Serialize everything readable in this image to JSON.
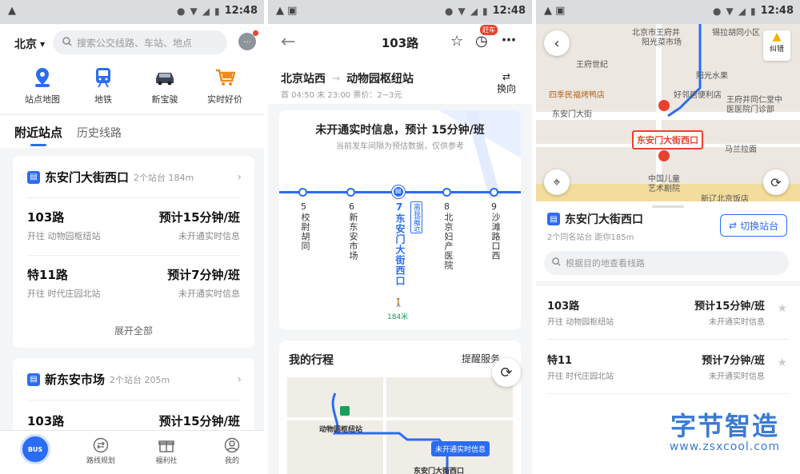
{
  "status": {
    "time": "12:48"
  },
  "s1": {
    "city": "北京",
    "search_placeholder": "搜索公交线路、车站、地点",
    "quick": [
      {
        "label": "站点地图",
        "icon": "pin-icon"
      },
      {
        "label": "地铁",
        "icon": "train-icon"
      },
      {
        "label": "新宝骏",
        "icon": "car-icon"
      },
      {
        "label": "实时好价",
        "icon": "cart-icon"
      }
    ],
    "tabs": {
      "active": "附近站点",
      "other": "历史线路"
    },
    "stop1": {
      "name": "东安门大街西口",
      "meta": "2个站台 184m",
      "rows": [
        {
          "route": "103路",
          "dir": "开往 动物园枢纽站",
          "eta": "预计15分钟/班",
          "rt": "未开通实时信息"
        },
        {
          "route": "特11路",
          "dir": "开往 时代庄园北站",
          "eta": "预计7分钟/班",
          "rt": "未开通实时信息"
        }
      ],
      "expand": "展开全部"
    },
    "stop2": {
      "name": "新东安市场",
      "meta": "2个站台 205m",
      "rows": [
        {
          "route": "103路",
          "eta": "预计15分钟/班"
        }
      ]
    },
    "nav": [
      {
        "label": "",
        "icon": "bus-icon"
      },
      {
        "label": "路线规划",
        "icon": "route-icon"
      },
      {
        "label": "福利社",
        "icon": "gift-icon"
      },
      {
        "label": "我的",
        "icon": "profile-icon"
      }
    ],
    "nav_bus_text": "BUS"
  },
  "s2": {
    "title": "103路",
    "catch_badge": "赶车",
    "from": "北京站西",
    "to": "动物园枢纽站",
    "schedule": "首 04:50 末 23:00 票价：2~3元",
    "reverse": "换向",
    "notice_main": "未开通实时信息，预计 15分钟/班",
    "notice_sub": "当前发车间隔为预估数据，仅供参考",
    "stations": [
      {
        "num": "5",
        "name": "校尉胡同"
      },
      {
        "num": "6",
        "name": "新东安市场"
      },
      {
        "num": "7",
        "name": "东安门大街西口"
      },
      {
        "num": "8",
        "name": "北京妇产医院"
      },
      {
        "num": "9",
        "name": "沙滩路口西"
      }
    ],
    "nearest_tag": "离我最近",
    "walk_dist": "184米",
    "trip_title": "我的行程",
    "remind": "提醒服务",
    "map_labels": {
      "terminal": "动物园枢纽站",
      "bubble": "未开通实时信息",
      "stop": "东安门大街西口"
    }
  },
  "s3": {
    "correct": "纠错",
    "map_pois": [
      "北京市王府井",
      "阳光菜市场",
      "锡拉胡同小区",
      "王府世纪",
      "阳光水果",
      "四季民福烤鸭店",
      "好邻居便利店",
      "王府井同仁堂中",
      "医医院门诊部",
      "东安门大街",
      "东安门大街西口",
      "马兰拉面",
      "中国儿童",
      "艺术剧院",
      "新辽北京饭店"
    ],
    "stop_name": "东安门大街西口",
    "switch": "切换站台",
    "meta": "2个同名站台 距你185m",
    "search_placeholder": "根据目的地查看线路",
    "rows": [
      {
        "route": "103路",
        "dir": "开往 动物园枢纽站",
        "eta": "预计15分钟/班",
        "rt": "未开通实时信息"
      },
      {
        "route": "特11",
        "dir": "开往 时代庄园北站",
        "eta": "预计7分钟/班",
        "rt": "未开通实时信息"
      }
    ]
  },
  "watermark": {
    "title": "字节智造",
    "url": "www.zsxcool.com"
  },
  "colors": {
    "accent": "#2a6df4",
    "red": "#e8422f",
    "status_bg": "#dadce0"
  }
}
